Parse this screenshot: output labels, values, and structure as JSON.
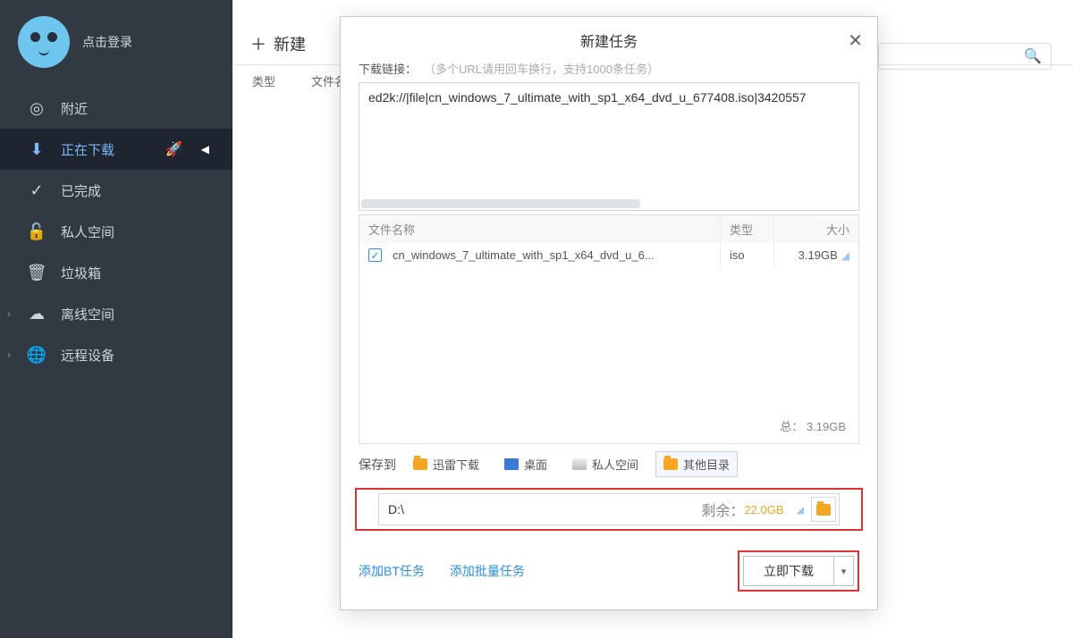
{
  "login_text": "点击登录",
  "sidebar": {
    "items": [
      {
        "icon": "◎",
        "label": "附近"
      },
      {
        "icon": "⬇",
        "label": "正在下载"
      },
      {
        "icon": "✓",
        "label": "已完成"
      },
      {
        "icon": "🔓",
        "label": "私人空间"
      },
      {
        "icon": "🗑",
        "label": "垃圾箱"
      },
      {
        "icon": "☁",
        "label": "离线空间"
      },
      {
        "icon": "🌐",
        "label": "远程设备"
      }
    ]
  },
  "toolbar": {
    "new_label": "新建"
  },
  "table_header": {
    "type": "类型",
    "filename": "文件名"
  },
  "dialog": {
    "title": "新建任务",
    "url_label": "下载链接：",
    "url_placeholder": "（多个URL请用回车换行，支持1000条任务）",
    "url_value": "ed2k://|file|cn_windows_7_ultimate_with_sp1_x64_dvd_u_677408.iso|3420557",
    "columns": {
      "name": "文件名称",
      "type": "类型",
      "size": "大小"
    },
    "file": {
      "name": "cn_windows_7_ultimate_with_sp1_x64_dvd_u_6...",
      "type": "iso",
      "size": "3.19GB"
    },
    "total_label": "总：",
    "total_size": "3.19GB",
    "save_to": "保存到",
    "save_options": {
      "xunlei": "迅雷下载",
      "desktop": "桌面",
      "private": "私人空间",
      "other": "其他目录"
    },
    "path": "D:\\",
    "free_label": "剩余：",
    "free_value": "22.0GB",
    "add_bt": "添加BT任务",
    "add_batch": "添加批量任务",
    "download_now": "立即下载"
  }
}
